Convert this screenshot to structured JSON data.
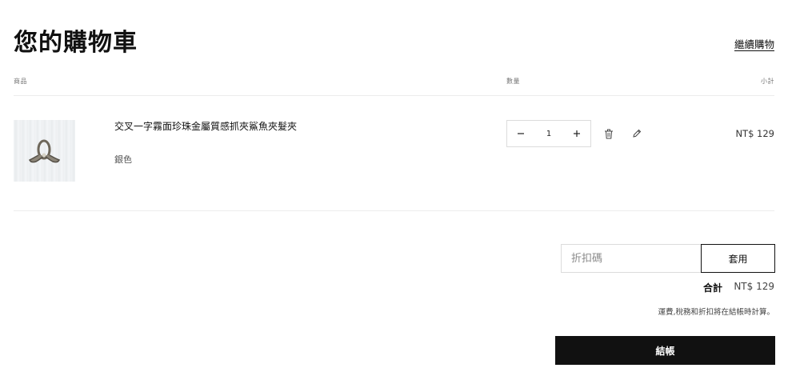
{
  "header": {
    "title": "您的購物車",
    "continue_link": "繼續購物"
  },
  "columns": {
    "product": "商品",
    "quantity": "數量",
    "subtotal": "小計"
  },
  "cart_items": [
    {
      "name": "交叉一字霧面珍珠金屬質感抓夾鯊魚夾髮夾",
      "variant": "銀色",
      "quantity": "1",
      "price": "NT$ 129",
      "image_icon": "hair-claw-clip-image"
    }
  ],
  "icons": {
    "minus": "minus-icon",
    "plus": "plus-icon",
    "remove": "trash-icon",
    "edit": "pencil-icon"
  },
  "summary": {
    "discount_placeholder": "折扣碼",
    "apply_label": "套用",
    "total_label": "合計",
    "total_value": "NT$ 129",
    "note": "運費,稅務和折扣將在結帳時計算。",
    "checkout_label": "結帳"
  },
  "colors": {
    "primary_button": "#111111",
    "divider": "#ececec"
  }
}
